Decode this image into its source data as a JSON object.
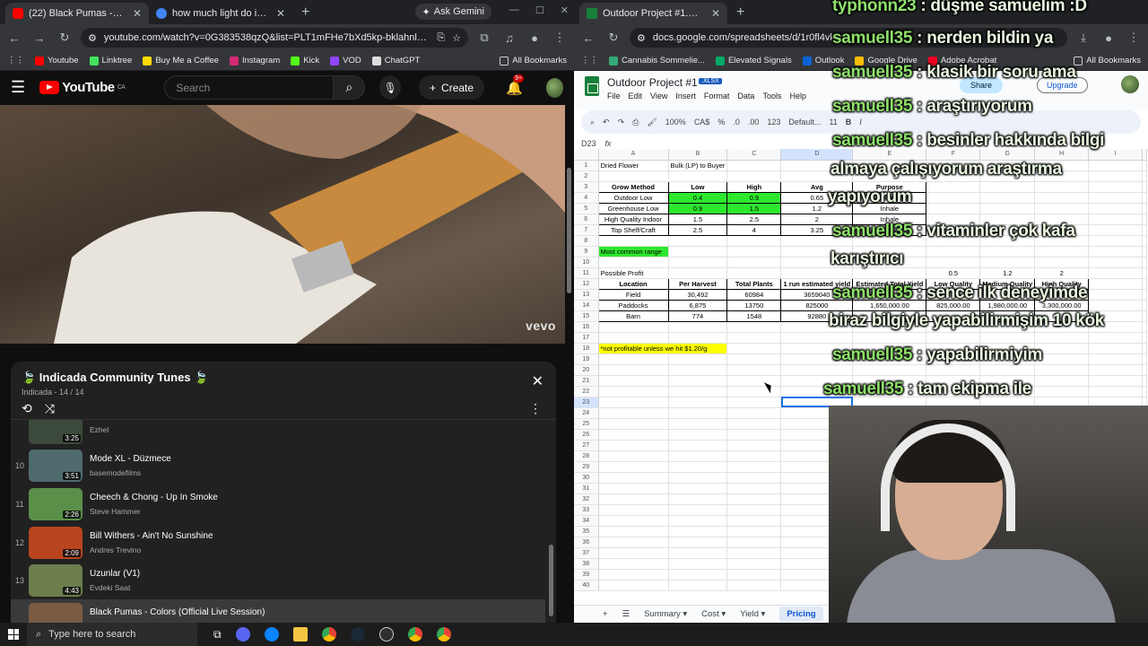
{
  "left_browser": {
    "tabs": [
      {
        "title": "(22) Black Pumas - Colors (",
        "active": true
      },
      {
        "title": "how much light do i need for 1",
        "active": false
      }
    ],
    "ask_gemini": "Ask Gemini",
    "url": "youtube.com/watch?v=0G383538qzQ&list=PLT1mFHe7bXd5kp-bklahnlazpohfEt1-2&i...",
    "bookmarks": [
      "Youtube",
      "Linktree",
      "Buy Me a Coffee",
      "Instagram",
      "Kick",
      "VOD",
      "ChatGPT"
    ],
    "all_bookmarks": "All Bookmarks"
  },
  "youtube": {
    "logo_text": "YouTube",
    "country": "CA",
    "search_placeholder": "Search",
    "create_label": "Create",
    "notif_count": "9+",
    "vevo": "vevo"
  },
  "playlist": {
    "title": "🍃 Indicada Community Tunes 🍃",
    "subtitle": "Indicada - 14 / 14",
    "items": [
      {
        "idx": "",
        "name": "",
        "channel": "Ezhel",
        "duration": "3:25",
        "color": "#3b4a3a"
      },
      {
        "idx": "10",
        "name": "Mode XL - Düzmece",
        "channel": "basemodefilms",
        "duration": "3:51",
        "color": "#4f6b6e"
      },
      {
        "idx": "11",
        "name": "Cheech & Chong - Up In Smoke",
        "channel": "Steve Hammer",
        "duration": "2:26",
        "color": "#5a8f4a"
      },
      {
        "idx": "12",
        "name": "Bill Withers - Ain't No Sunshine",
        "channel": "Andres Trevino",
        "duration": "2:09",
        "color": "#b8451f"
      },
      {
        "idx": "13",
        "name": "Uzunlar (V1)",
        "channel": "Evdeki Saat",
        "duration": "4:43",
        "color": "#6b7e4c"
      },
      {
        "idx": "",
        "name": "Black Pumas - Colors (Official Live Session)",
        "channel": "Black Pumas",
        "duration": "6:47",
        "color": "#7a5b43"
      }
    ]
  },
  "right_browser": {
    "tabs": [
      {
        "title": "Outdoor Project #1.xlsx - Goog",
        "active": true
      }
    ],
    "url": "docs.google.com/spreadsheets/d/1r0fl4vkxob...",
    "bookmarks": [
      "Cannabis Sommelie...",
      "Elevated Signals",
      "Outlook",
      "Google Drive",
      "Adobe Acrobat"
    ],
    "all_bookmarks": "All Bookmarks"
  },
  "sheet": {
    "doc_title": "Outdoor Project #1",
    "badge": ".XLSX",
    "menu": [
      "File",
      "Edit",
      "View",
      "Insert",
      "Format",
      "Data",
      "Tools",
      "Help"
    ],
    "share": "Share",
    "upgrade": "Upgrade",
    "zoom": "100%",
    "currency": "CA$",
    "font": "Default...",
    "font_size": "11",
    "cell_ref": "D23",
    "columns": [
      "A",
      "B",
      "C",
      "D",
      "E",
      "F",
      "G",
      "H",
      "I"
    ],
    "rows": {
      "r1": [
        "Dried Flower",
        "Bulk (LP) to Buyer"
      ],
      "r3": [
        "Grow Method",
        "Low",
        "High",
        "Avg",
        "Purpose"
      ],
      "r4": [
        "Outdoor Low",
        "0.4",
        "0.9",
        "0.65",
        "Extract"
      ],
      "r5": [
        "Greenhouse Low",
        "0.9",
        "1.5",
        "1.2",
        "Inhale"
      ],
      "r6": [
        "High Quality Indoor",
        "1.5",
        "2.5",
        "2",
        "Inhale"
      ],
      "r7": [
        "Top Shelf/Craft",
        "2.5",
        "4",
        "3.25",
        "Inhale"
      ],
      "r9": "Most common range",
      "r11": [
        "Possible Profit",
        "0.5",
        "1.2",
        "2"
      ],
      "r12": [
        "Location",
        "Per Harvest",
        "Total Plants",
        "1 run estimated yield",
        "Estimated Total Yield",
        "Low Quality",
        "Medium Quality",
        "High Quality"
      ],
      "r13": [
        "Field",
        "30,492",
        "60984",
        "3659040",
        "",
        "",
        "",
        "3,300,000.00"
      ],
      "r14": [
        "Paddocks",
        "6,875",
        "13750",
        "825000",
        "1,650,000.00",
        "825,000.00",
        "1,980,000.00",
        "3,300,000.00"
      ],
      "r15": [
        "Barn",
        "774",
        "1548",
        "92880",
        "",
        "",
        "",
        ""
      ],
      "r18": "*not profitable unless we hit $1.20/g"
    },
    "sheet_tabs": [
      "Summary",
      "Cost",
      "Yield",
      "Pricing"
    ]
  },
  "chat": [
    {
      "user": "typhonn23",
      "msg": "düşme samuelim :D"
    },
    {
      "user": "samuell35",
      "msg": "nerden bildin ya"
    },
    {
      "user": "samuell35",
      "msg": "klasik bir soru ama"
    },
    {
      "user": "samuell35",
      "msg": "araştırıyorum"
    },
    {
      "user": "samuell35",
      "msg": "besinler hakkında bilgi"
    },
    {
      "user": "",
      "msg": "almaya çalışıyorum araştırma"
    },
    {
      "user": "",
      "msg": "yapıyorum"
    },
    {
      "user": "samuell35",
      "msg": "vitaminler çok kafa"
    },
    {
      "user": "",
      "msg": "karıştırıcı"
    },
    {
      "user": "samuell35",
      "msg": "sence ilk deneyimde"
    },
    {
      "user": "",
      "msg": "biraz bilgiyle yapabilirmişim 10 kök"
    },
    {
      "user": "samuell35",
      "msg": "yapabilirmiyim"
    },
    {
      "user": "samuell35",
      "msg": "tam ekipma ile"
    }
  ],
  "taskbar": {
    "search_placeholder": "Type here to search"
  }
}
